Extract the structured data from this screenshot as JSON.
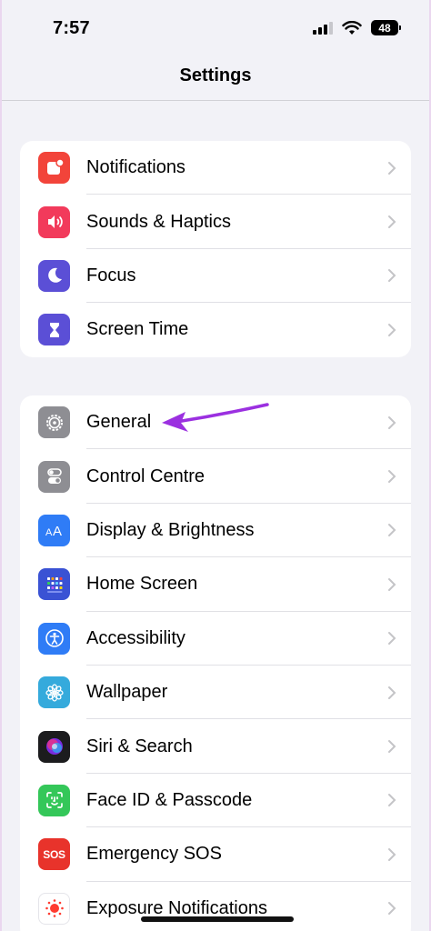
{
  "status": {
    "time": "7:57",
    "battery": "48"
  },
  "nav": {
    "title": "Settings"
  },
  "group1": [
    {
      "label": "Notifications",
      "icon": "notifications-icon",
      "color": "#f2443a"
    },
    {
      "label": "Sounds & Haptics",
      "icon": "speaker-icon",
      "color": "#f23a5b"
    },
    {
      "label": "Focus",
      "icon": "moon-icon",
      "color": "#5b4fd6"
    },
    {
      "label": "Screen Time",
      "icon": "hourglass-icon",
      "color": "#5b4fd6"
    }
  ],
  "group2": [
    {
      "label": "General",
      "icon": "gear-icon",
      "color": "#8e8e93"
    },
    {
      "label": "Control Centre",
      "icon": "toggles-icon",
      "color": "#8e8e93"
    },
    {
      "label": "Display & Brightness",
      "icon": "text-size-icon",
      "color": "#2f7cf6"
    },
    {
      "label": "Home Screen",
      "icon": "app-grid-icon",
      "color": "#3a52d4"
    },
    {
      "label": "Accessibility",
      "icon": "accessibility-icon",
      "color": "#2f7cf6"
    },
    {
      "label": "Wallpaper",
      "icon": "flower-icon",
      "color": "#35aadc"
    },
    {
      "label": "Siri & Search",
      "icon": "siri-icon",
      "color": "#222222"
    },
    {
      "label": "Face ID & Passcode",
      "icon": "face-id-icon",
      "color": "#34c759"
    },
    {
      "label": "Emergency SOS",
      "icon": "sos-icon",
      "color": "#e8332b"
    },
    {
      "label": "Exposure Notifications",
      "icon": "exposure-icon",
      "color": "#ffffff"
    }
  ],
  "sos_text": "SOS"
}
